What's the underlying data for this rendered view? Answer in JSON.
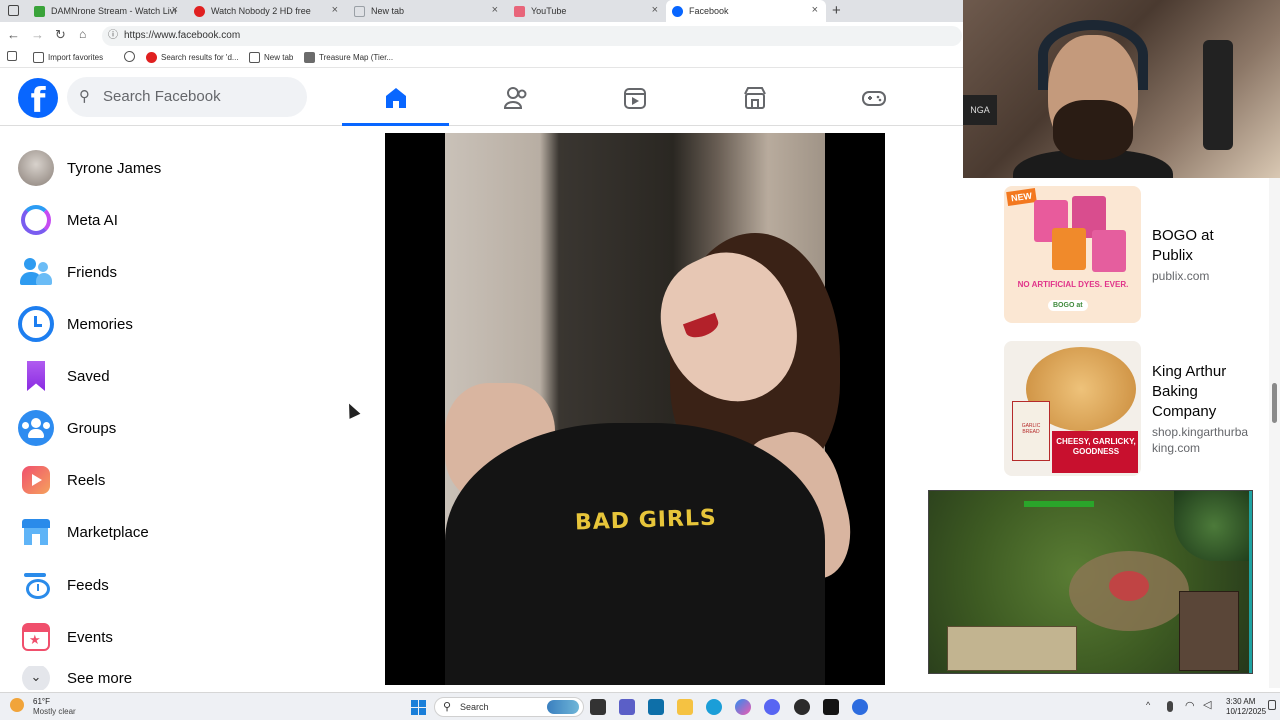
{
  "browser": {
    "tabs": [
      {
        "label": "DAMNrone Stream - Watch Live",
        "icon_color": "#3aa33a"
      },
      {
        "label": "Watch Nobody 2 HD free",
        "icon_color": "#e02020"
      },
      {
        "label": "New tab",
        "icon_color": "#9aa0a6"
      },
      {
        "label": "YouTube",
        "icon_color": "#e8657a"
      },
      {
        "label": "Facebook",
        "icon_color": "#0866ff"
      }
    ],
    "url": "https://www.facebook.com",
    "bookmarks": [
      {
        "label": "Import favorites"
      },
      {
        "label": "Search results for 'd..."
      },
      {
        "label": "New tab"
      },
      {
        "label": "Treasure Map (Tier..."
      }
    ]
  },
  "facebook": {
    "search_placeholder": "Search Facebook",
    "brand_color": "#0866ff",
    "nav_icons": [
      "home-icon",
      "friends-icon",
      "video-icon",
      "marketplace-icon",
      "gaming-icon"
    ],
    "sidebar": [
      {
        "label": "Tyrone James",
        "icon": "avatar"
      },
      {
        "label": "Meta AI",
        "icon": "meta-ai-icon"
      },
      {
        "label": "Friends",
        "icon": "friends-icon"
      },
      {
        "label": "Memories",
        "icon": "memories-icon"
      },
      {
        "label": "Saved",
        "icon": "saved-icon"
      },
      {
        "label": "Groups",
        "icon": "groups-icon"
      },
      {
        "label": "Reels",
        "icon": "reels-icon"
      },
      {
        "label": "Marketplace",
        "icon": "marketplace-icon"
      },
      {
        "label": "Feeds",
        "icon": "feeds-icon"
      },
      {
        "label": "Events",
        "icon": "events-icon"
      },
      {
        "label": "See more",
        "icon": "chevron-down-icon"
      }
    ],
    "video": {
      "shirt_text": "BAD GIRLS"
    },
    "ads": [
      {
        "title": "BOGO at Publix",
        "domain": "publix.com",
        "image_text": [
          "NEW",
          "NO ARTIFICIAL DYES. EVER.",
          "BOGO at"
        ]
      },
      {
        "title": "King Arthur Baking Company",
        "domain": "shop.kingarthurbaking.com",
        "image_text": [
          "CHEESY, GARLICKY, GOODNESS",
          "GARLIC BREAD"
        ]
      }
    ]
  },
  "stream_overlay": {
    "webcam_sign": "NGA"
  },
  "taskbar": {
    "weather_temp": "61°F",
    "weather_desc": "Mostly clear",
    "search_label": "Search",
    "time": "3:30 AM",
    "date": "10/12/2025"
  }
}
